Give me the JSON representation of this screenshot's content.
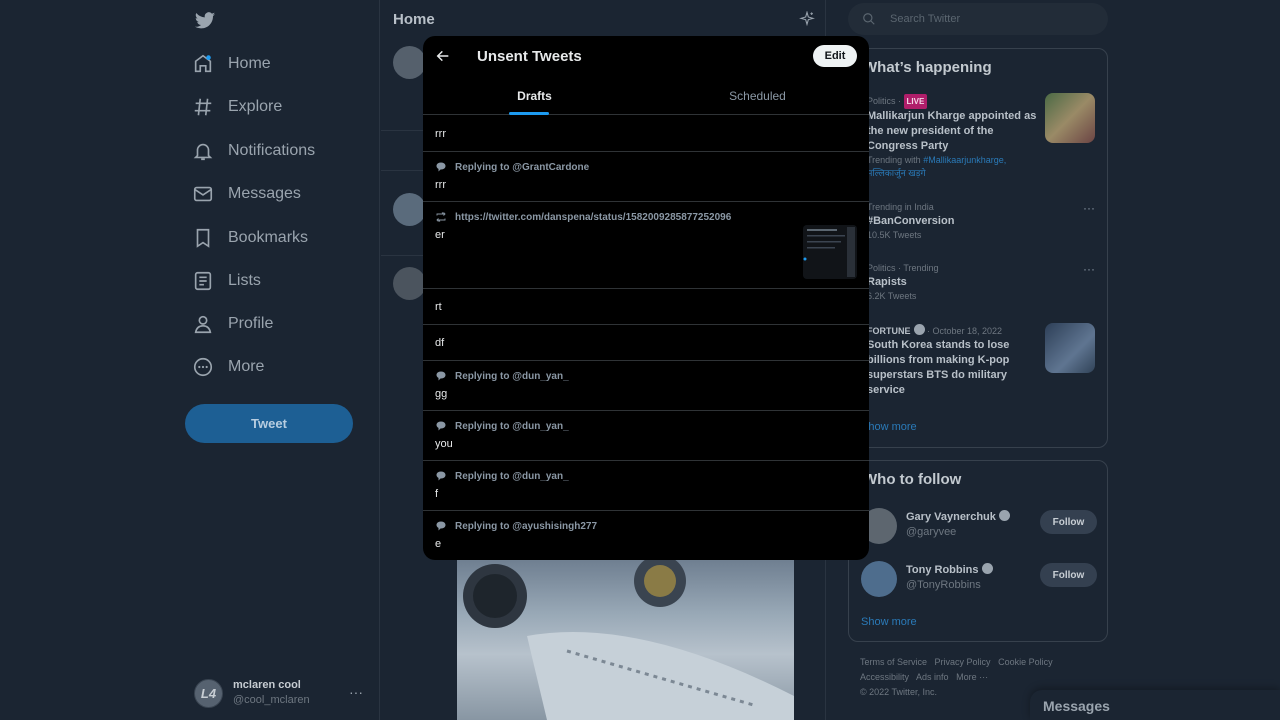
{
  "nav": {
    "items": [
      {
        "label": "Home",
        "icon": "home-icon"
      },
      {
        "label": "Explore",
        "icon": "hashtag-icon"
      },
      {
        "label": "Notifications",
        "icon": "bell-icon"
      },
      {
        "label": "Messages",
        "icon": "envelope-icon"
      },
      {
        "label": "Bookmarks",
        "icon": "bookmark-icon"
      },
      {
        "label": "Lists",
        "icon": "list-icon"
      },
      {
        "label": "Profile",
        "icon": "person-icon"
      },
      {
        "label": "More",
        "icon": "more-circle-icon"
      }
    ],
    "tweet_button": "Tweet",
    "account": {
      "display_name": "mclaren cool",
      "handle": "@cool_mclaren",
      "avatar_text": "L4"
    }
  },
  "timeline": {
    "title": "Home"
  },
  "search": {
    "placeholder": "Search Twitter"
  },
  "whats_happening": {
    "title": "What’s happening",
    "trends": [
      {
        "meta": "Politics · ",
        "badge": "LIVE",
        "title": "Mallikarjun Kharge appointed as the new president of the Congress Party",
        "trending_with_prefix": "Trending with ",
        "trending_with_tags": "#Mallikaarjunkharge, मल्लिकार्जुन खड़गे"
      },
      {
        "meta": "Trending in India",
        "title": "#BanConversion",
        "count": "10.5K Tweets"
      },
      {
        "meta": "Politics · Trending",
        "title": "Rapists",
        "count": "6.2K Tweets"
      },
      {
        "source": "FORTUNE",
        "date": " · October 18, 2022",
        "title": "South Korea stands to lose billions from making K-pop superstars BTS do military service"
      }
    ],
    "show_more": "Show more"
  },
  "who_to_follow": {
    "title": "Who to follow",
    "users": [
      {
        "name": "Gary Vaynerchuk",
        "handle": "@garyvee",
        "button": "Follow"
      },
      {
        "name": "Tony Robbins",
        "handle": "@TonyRobbins",
        "button": "Follow"
      }
    ],
    "show_more": "Show more"
  },
  "footer": {
    "links": [
      "Terms of Service",
      "Privacy Policy",
      "Cookie Policy",
      "Accessibility",
      "Ads info",
      "More ···"
    ],
    "copyright": "© 2022 Twitter, Inc."
  },
  "messages_drawer": {
    "title": "Messages"
  },
  "modal": {
    "title": "Unsent Tweets",
    "edit_label": "Edit",
    "tabs": [
      {
        "label": "Drafts"
      },
      {
        "label": "Scheduled"
      }
    ],
    "drafts": [
      {
        "context": "",
        "text": "rrr"
      },
      {
        "context": "Replying to @GrantCardone",
        "context_icon": "reply-bubble-icon",
        "text": "rrr"
      },
      {
        "context": "https://twitter.com/danspena/status/1582009285877252096",
        "context_icon": "retweet-icon",
        "text": "er",
        "has_media": true
      },
      {
        "context": "",
        "text": "rt"
      },
      {
        "context": "",
        "text": "df"
      },
      {
        "context": "Replying to @dun_yan_",
        "context_icon": "reply-bubble-icon",
        "text": "gg"
      },
      {
        "context": "Replying to @dun_yan_",
        "context_icon": "reply-bubble-icon",
        "text": "you"
      },
      {
        "context": "Replying to @dun_yan_",
        "context_icon": "reply-bubble-icon",
        "text": "f"
      },
      {
        "context": "Replying to @ayushisingh277",
        "context_icon": "reply-bubble-icon",
        "text": "e"
      }
    ]
  },
  "colors": {
    "accent": "#1d9bf0",
    "background": "#1b2532",
    "modal": "#000000",
    "live_badge": "#b01e6a"
  }
}
